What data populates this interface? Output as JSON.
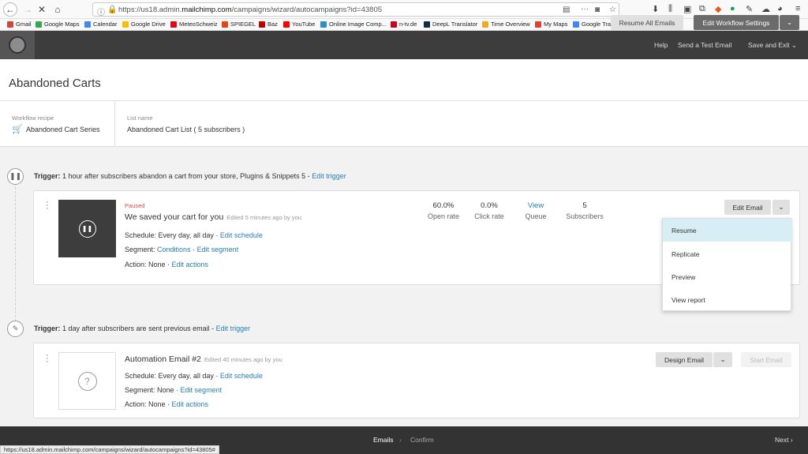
{
  "browser": {
    "url_prefix": "https://us18.admin.",
    "url_domain": "mailchimp.com",
    "url_suffix": "/campaigns/wizard/autocampaigns?id=43805",
    "more_icon": "···",
    "bookmarks": [
      {
        "label": "Gmail",
        "color": "#d44638"
      },
      {
        "label": "Google Maps",
        "color": "#34a853"
      },
      {
        "label": "Calendar",
        "color": "#4285f4"
      },
      {
        "label": "Google Drive",
        "color": "#fbbc05"
      },
      {
        "label": "MeteoSchweiz",
        "color": "#e30613"
      },
      {
        "label": "SPIEGEL",
        "color": "#e64415"
      },
      {
        "label": "Baz",
        "color": "#c00000"
      },
      {
        "label": "YouTube",
        "color": "#ff0000"
      },
      {
        "label": "Online Image Comp...",
        "color": "#2c8fc9"
      },
      {
        "label": "n-tv.de",
        "color": "#d0021b"
      },
      {
        "label": "DeepL Translator",
        "color": "#0f2b46"
      },
      {
        "label": "Time Overview",
        "color": "#f5a623"
      },
      {
        "label": "My Maps",
        "color": "#db4437"
      },
      {
        "label": "Google Translate",
        "color": "#4285f4"
      }
    ]
  },
  "topbar": {
    "help": "Help",
    "send_test": "Send a Test Email",
    "save_exit": "Save and Exit",
    "save_exit_caret": "⌄"
  },
  "header": {
    "title": "Abandoned Carts",
    "resume_all": "Resume All Emails",
    "edit_workflow": "Edit Workflow Settings",
    "dropdown_caret": "⌄"
  },
  "info": {
    "recipe_label": "Workflow recipe",
    "recipe_value": "Abandoned Cart Series",
    "list_label": "List name",
    "list_value": "Abandoned Cart List ( 5 subscribers )"
  },
  "trigger1": {
    "label": "Trigger:",
    "text": " 1 hour after subscribers abandon a cart from your store, Plugins & Snippets 5 - ",
    "edit": "Edit trigger"
  },
  "email1": {
    "status": "Paused",
    "name": "We saved your cart for you",
    "edited": "Edited 5 minutes ago by you",
    "schedule_label": "Schedule:",
    "schedule_value": " Every day, all day · ",
    "edit_schedule": "Edit schedule",
    "segment_label": "Segment:",
    "segment_value": " Conditions",
    "segment_sep": " · ",
    "edit_segment": "Edit segment",
    "action_label": "Action:",
    "action_value": " None · ",
    "edit_actions": "Edit actions",
    "stats": {
      "open_rate": "60.0%",
      "open_label": "Open rate",
      "click_rate": "0.0%",
      "click_label": "Click rate",
      "view": "View",
      "queue": "Queue",
      "subscribers": "5",
      "subscribers_label": "Subscribers"
    },
    "edit_button": "Edit Email",
    "menu": [
      "Resume",
      "Replicate",
      "Preview",
      "View report"
    ]
  },
  "trigger2": {
    "label": "Trigger:",
    "text": " 1 day after subscribers are sent previous email - ",
    "edit": "Edit trigger"
  },
  "email2": {
    "name": "Automation Email #2",
    "edited": "Edited 40 minutes ago by you",
    "schedule_label": "Schedule:",
    "schedule_value": " Every day, all day · ",
    "edit_schedule": "Edit schedule",
    "segment_label": "Segment:",
    "segment_value": " None · ",
    "edit_segment": "Edit segment",
    "action_label": "Action:",
    "action_value": " None · ",
    "edit_actions": "Edit actions",
    "design_button": "Design Email",
    "start_button": "Start Email"
  },
  "footer": {
    "step1": "Emails",
    "sep": "›",
    "step2": "Confirm",
    "next": "Next",
    "next_caret": "›"
  },
  "status_url": "https://us18.admin.mailchimp.com/campaigns/wizard/autocampaigns?id=43805#"
}
